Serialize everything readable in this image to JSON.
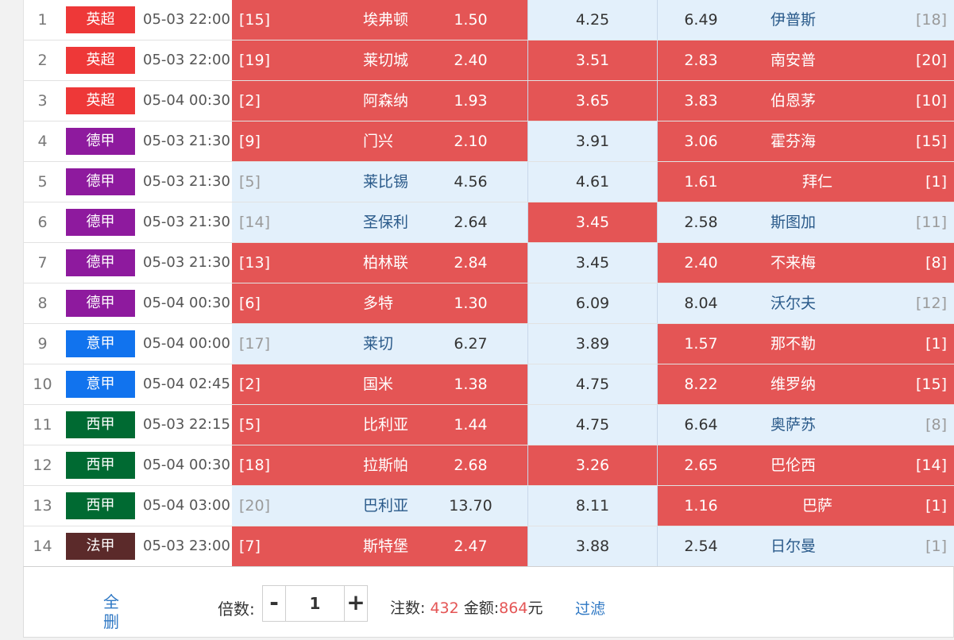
{
  "colors": {
    "selected": "#e45555",
    "unselected": "#e3f0fb",
    "leagues": {
      "英超": "#ee3838",
      "德甲": "#8e1a9e",
      "意甲": "#1173ee",
      "西甲": "#006a32",
      "法甲": "#5b2a2a"
    }
  },
  "matches": [
    {
      "idx": "1",
      "league": "英超",
      "time": "05-03 22:00",
      "home_rank": "[15]",
      "home": "埃弗顿",
      "odd_h": "1.50",
      "odd_d": "4.25",
      "odd_a": "6.49",
      "away": "伊普斯",
      "away_rank": "[18]",
      "sel": [
        true,
        false,
        false
      ]
    },
    {
      "idx": "2",
      "league": "英超",
      "time": "05-03 22:00",
      "home_rank": "[19]",
      "home": "莱切城",
      "odd_h": "2.40",
      "odd_d": "3.51",
      "odd_a": "2.83",
      "away": "南安普",
      "away_rank": "[20]",
      "sel": [
        true,
        true,
        true
      ]
    },
    {
      "idx": "3",
      "league": "英超",
      "time": "05-04 00:30",
      "home_rank": "[2]",
      "home": "阿森纳",
      "odd_h": "1.93",
      "odd_d": "3.65",
      "odd_a": "3.83",
      "away": "伯恩茅",
      "away_rank": "[10]",
      "sel": [
        true,
        true,
        true
      ]
    },
    {
      "idx": "4",
      "league": "德甲",
      "time": "05-03 21:30",
      "home_rank": "[9]",
      "home": "门兴",
      "odd_h": "2.10",
      "odd_d": "3.91",
      "odd_a": "3.06",
      "away": "霍芬海",
      "away_rank": "[15]",
      "sel": [
        true,
        false,
        true
      ]
    },
    {
      "idx": "5",
      "league": "德甲",
      "time": "05-03 21:30",
      "home_rank": "[5]",
      "home": "莱比锡",
      "odd_h": "4.56",
      "odd_d": "4.61",
      "odd_a": "1.61",
      "away": "拜仁",
      "away_rank": "[1]",
      "sel": [
        false,
        false,
        true
      ]
    },
    {
      "idx": "6",
      "league": "德甲",
      "time": "05-03 21:30",
      "home_rank": "[14]",
      "home": "圣保利",
      "odd_h": "2.64",
      "odd_d": "3.45",
      "odd_a": "2.58",
      "away": "斯图加",
      "away_rank": "[11]",
      "sel": [
        false,
        true,
        false
      ]
    },
    {
      "idx": "7",
      "league": "德甲",
      "time": "05-03 21:30",
      "home_rank": "[13]",
      "home": "柏林联",
      "odd_h": "2.84",
      "odd_d": "3.45",
      "odd_a": "2.40",
      "away": "不来梅",
      "away_rank": "[8]",
      "sel": [
        true,
        false,
        true
      ]
    },
    {
      "idx": "8",
      "league": "德甲",
      "time": "05-04 00:30",
      "home_rank": "[6]",
      "home": "多特",
      "odd_h": "1.30",
      "odd_d": "6.09",
      "odd_a": "8.04",
      "away": "沃尔夫",
      "away_rank": "[12]",
      "sel": [
        true,
        false,
        false
      ]
    },
    {
      "idx": "9",
      "league": "意甲",
      "time": "05-04 00:00",
      "home_rank": "[17]",
      "home": "莱切",
      "odd_h": "6.27",
      "odd_d": "3.89",
      "odd_a": "1.57",
      "away": "那不勒",
      "away_rank": "[1]",
      "sel": [
        false,
        false,
        true
      ]
    },
    {
      "idx": "10",
      "league": "意甲",
      "time": "05-04 02:45",
      "home_rank": "[2]",
      "home": "国米",
      "odd_h": "1.38",
      "odd_d": "4.75",
      "odd_a": "8.22",
      "away": "维罗纳",
      "away_rank": "[15]",
      "sel": [
        true,
        false,
        true
      ]
    },
    {
      "idx": "11",
      "league": "西甲",
      "time": "05-03 22:15",
      "home_rank": "[5]",
      "home": "比利亚",
      "odd_h": "1.44",
      "odd_d": "4.75",
      "odd_a": "6.64",
      "away": "奥萨苏",
      "away_rank": "[8]",
      "sel": [
        true,
        false,
        false
      ]
    },
    {
      "idx": "12",
      "league": "西甲",
      "time": "05-04 00:30",
      "home_rank": "[18]",
      "home": "拉斯帕",
      "odd_h": "2.68",
      "odd_d": "3.26",
      "odd_a": "2.65",
      "away": "巴伦西",
      "away_rank": "[14]",
      "sel": [
        true,
        true,
        true
      ]
    },
    {
      "idx": "13",
      "league": "西甲",
      "time": "05-04 03:00",
      "home_rank": "[20]",
      "home": "巴利亚",
      "odd_h": "13.70",
      "odd_d": "8.11",
      "odd_a": "1.16",
      "away": "巴萨",
      "away_rank": "[1]",
      "sel": [
        false,
        false,
        true
      ]
    },
    {
      "idx": "14",
      "league": "法甲",
      "time": "05-03 23:00",
      "home_rank": "[7]",
      "home": "斯特堡",
      "odd_h": "2.47",
      "odd_d": "3.88",
      "odd_a": "2.54",
      "away": "日尔曼",
      "away_rank": "[1]",
      "sel": [
        true,
        false,
        false
      ]
    }
  ],
  "footer": {
    "clear_all": "全删",
    "multiplier_label": "倍数:",
    "minus": "-",
    "plus": "+",
    "multiplier_value": "1",
    "bets_label": "注数:",
    "bets_value": "432",
    "amount_label": "金额:",
    "amount_value": "864",
    "amount_unit": "元",
    "filter": "过滤"
  }
}
